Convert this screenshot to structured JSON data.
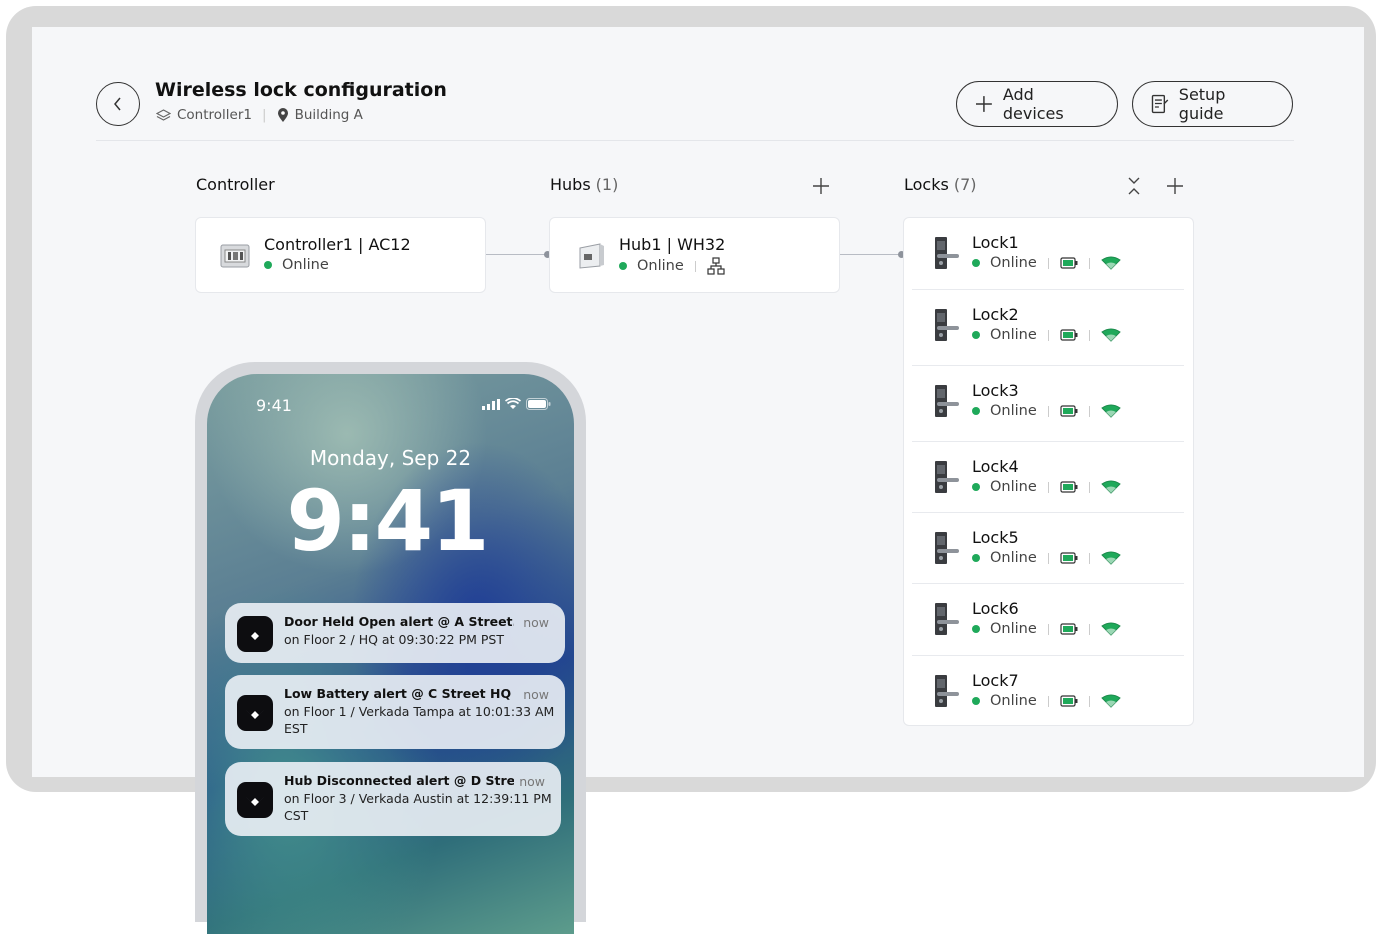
{
  "header": {
    "title": "Wireless lock configuration",
    "controller_crumb": "Controller1",
    "location_crumb": "Building A",
    "add_devices_label": "Add devices",
    "setup_guide_label": "Setup guide"
  },
  "columns": {
    "controller_label": "Controller",
    "hubs_label": "Hubs",
    "hubs_count": "(1)",
    "locks_label": "Locks",
    "locks_count": "(7)"
  },
  "controller": {
    "name": "Controller1 | AC12",
    "status": "Online"
  },
  "hub": {
    "name": "Hub1 | WH32",
    "status": "Online"
  },
  "locks": [
    {
      "name": "Lock1",
      "status": "Online"
    },
    {
      "name": "Lock2",
      "status": "Online"
    },
    {
      "name": "Lock3",
      "status": "Online"
    },
    {
      "name": "Lock4",
      "status": "Online"
    },
    {
      "name": "Lock5",
      "status": "Online"
    },
    {
      "name": "Lock6",
      "status": "Online"
    },
    {
      "name": "Lock7",
      "status": "Online"
    }
  ],
  "phone": {
    "status_time": "9:41",
    "date": "Monday, Sep 22",
    "clock": "9:41",
    "notifications": [
      {
        "title": "Door Held Open alert @ A Street....",
        "body": "on Floor 2 / HQ at 09:30:22 PM PST",
        "time": "now"
      },
      {
        "title": "Low Battery alert @ C Street HQ",
        "body": "on Floor 1 / Verkada Tampa at 10:01:33 AM EST",
        "time": "now"
      },
      {
        "title": "Hub Disconnected alert @ D Street",
        "body": "on Floor 3 / Verkada Austin at 12:39:11 PM CST",
        "time": "now"
      }
    ]
  },
  "colors": {
    "online": "#1fa95a",
    "battery": "#1fa95a",
    "signal": "#1fa95a",
    "frame": "#d9d9d9",
    "canvas": "#f6f7f9"
  },
  "icons": [
    "chevron-left-icon",
    "layers-icon",
    "map-pin-icon",
    "plus-icon",
    "guide-icon",
    "collapse-icon",
    "battery-icon",
    "signal-icon",
    "network-icon",
    "cellular-icon",
    "wifi-icon",
    "battery-status-icon",
    "verkada-logo-icon"
  ]
}
